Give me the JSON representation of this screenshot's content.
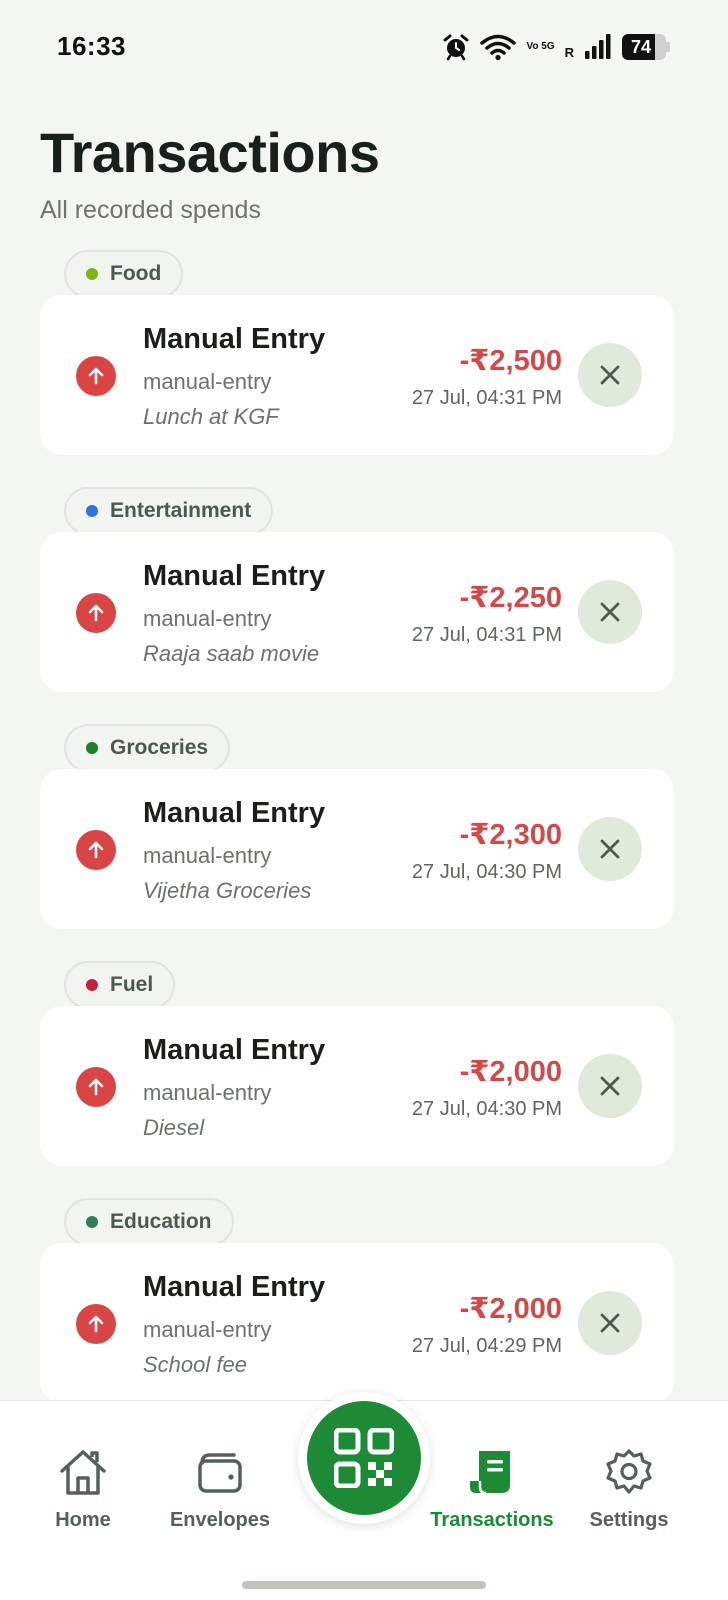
{
  "status_bar": {
    "time": "16:33",
    "network": "Vo 5G",
    "roaming": "R",
    "battery_level": "74",
    "battery_fraction": 0.74
  },
  "header": {
    "title": "Transactions",
    "subtitle": "All recorded spends"
  },
  "colors": {
    "accent": "#1d8a36",
    "expense": "#d04a4a"
  },
  "transactions": [
    {
      "category": "Food",
      "category_color": "#7cb518",
      "title": "Manual Entry",
      "source": "manual-entry",
      "note": "Lunch at KGF",
      "amount": "-₹2,500",
      "date": "27 Jul, 04:31 PM"
    },
    {
      "category": "Entertainment",
      "category_color": "#2f6fe0",
      "title": "Manual Entry",
      "source": "manual-entry",
      "note": "Raaja saab movie",
      "amount": "-₹2,250",
      "date": "27 Jul, 04:31 PM"
    },
    {
      "category": "Groceries",
      "category_color": "#16802b",
      "title": "Manual Entry",
      "source": "manual-entry",
      "note": "Vijetha Groceries",
      "amount": "-₹2,300",
      "date": "27 Jul, 04:30 PM"
    },
    {
      "category": "Fuel",
      "category_color": "#c0213f",
      "title": "Manual Entry",
      "source": "manual-entry",
      "note": "Diesel",
      "amount": "-₹2,000",
      "date": "27 Jul, 04:30 PM"
    },
    {
      "category": "Education",
      "category_color": "#2e7d57",
      "title": "Manual Entry",
      "source": "manual-entry",
      "note": "School fee",
      "amount": "-₹2,000",
      "date": "27 Jul, 04:29 PM"
    }
  ],
  "bottom_nav": {
    "home": {
      "label": "Home",
      "icon": "home-icon"
    },
    "envelopes": {
      "label": "Envelopes",
      "icon": "wallet-icon"
    },
    "scan": {
      "icon": "qr-code-icon"
    },
    "transactions": {
      "label": "Transactions",
      "icon": "receipt-icon",
      "active": true
    },
    "settings": {
      "label": "Settings",
      "icon": "gear-icon"
    }
  }
}
